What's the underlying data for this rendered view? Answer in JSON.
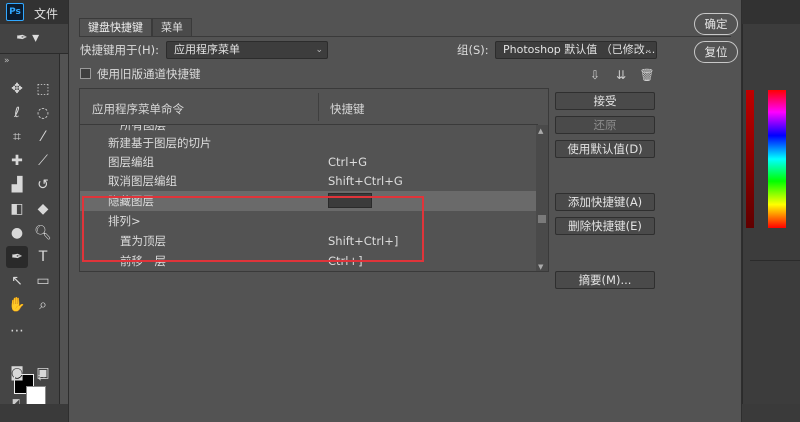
{
  "app": {
    "logo": "Ps",
    "menu_file": "文件"
  },
  "dialog": {
    "tabs": [
      {
        "label": "键盘快捷键"
      },
      {
        "label": "菜单"
      }
    ],
    "shortcuts_for_label": "快捷键用于(H):",
    "shortcuts_for_value": "应用程序菜单",
    "set_label": "组(S):",
    "set_value": "Photoshop 默认值 （已修改...",
    "legacy_checkbox_label": "使用旧版通道快捷键",
    "table": {
      "col_command": "应用程序菜单命令",
      "col_shortcut": "快捷键",
      "rows": [
        {
          "command": "所有图层",
          "shortcut": ""
        },
        {
          "command": "新建基于图层的切片",
          "shortcut": ""
        },
        {
          "command": "图层编组",
          "shortcut": "Ctrl+G"
        },
        {
          "command": "取消图层编组",
          "shortcut": "Shift+Ctrl+G"
        },
        {
          "command": "隐藏图层",
          "shortcut": ""
        },
        {
          "command": "排列>",
          "shortcut": ""
        },
        {
          "command": "置为顶层",
          "shortcut": "Shift+Ctrl+]"
        },
        {
          "command": "前移一层",
          "shortcut": "Ctrl+]"
        }
      ]
    },
    "buttons": {
      "accept": "接受",
      "undo": "还原",
      "use_default": "使用默认值(D)",
      "add_shortcut": "添加快捷键(A)",
      "delete_shortcut": "删除快捷键(E)",
      "summarize": "摘要(M)...",
      "ok": "确定",
      "reset": "复位"
    }
  }
}
